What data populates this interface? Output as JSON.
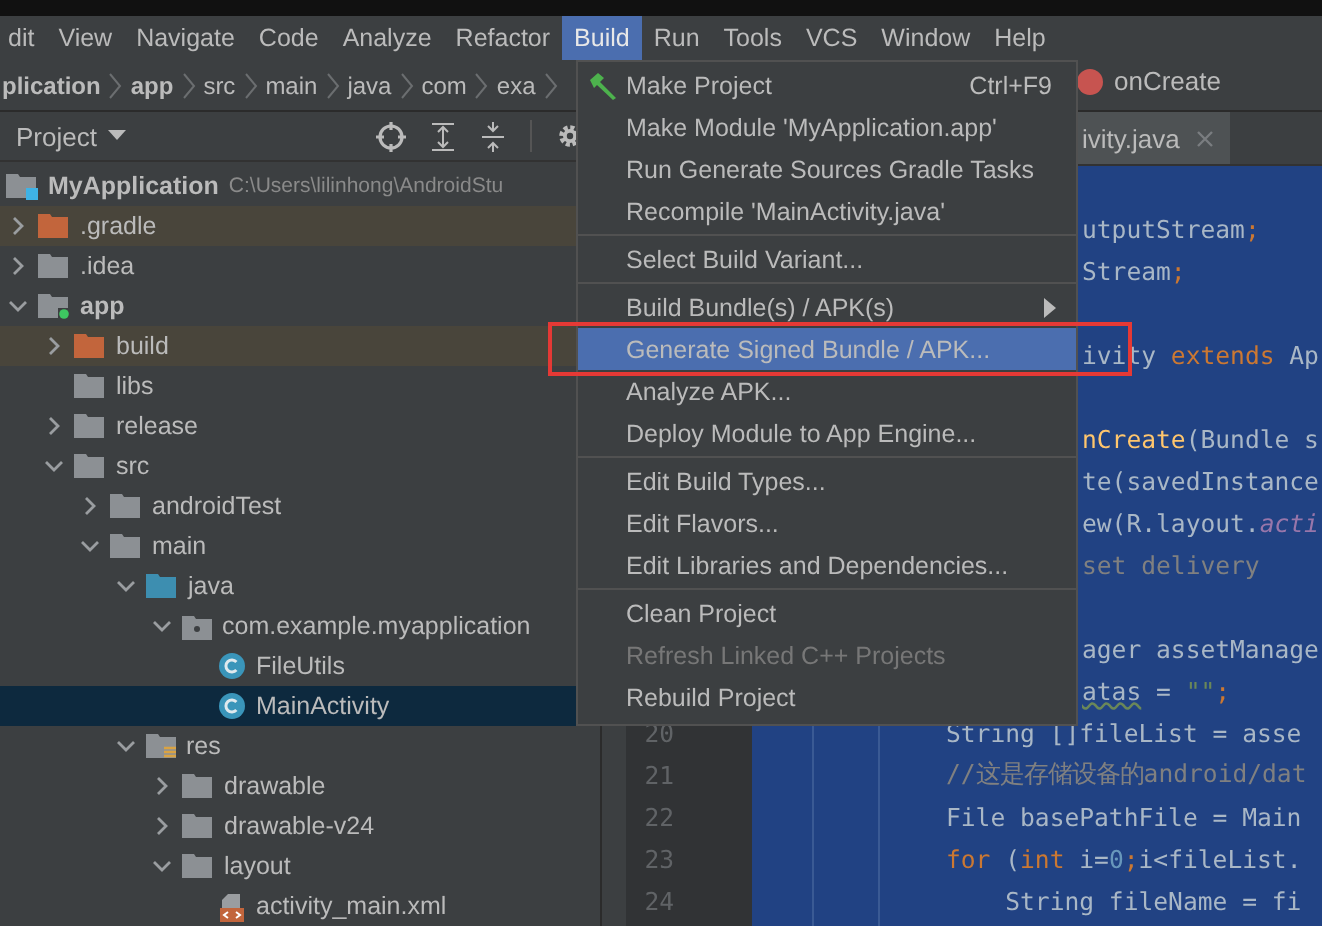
{
  "menu_bar": [
    {
      "label": "dit",
      "selected": false
    },
    {
      "label": "View",
      "selected": false
    },
    {
      "label": "Navigate",
      "selected": false
    },
    {
      "label": "Code",
      "selected": false
    },
    {
      "label": "Analyze",
      "selected": false
    },
    {
      "label": "Refactor",
      "selected": false
    },
    {
      "label": "Build",
      "selected": true
    },
    {
      "label": "Run",
      "selected": false
    },
    {
      "label": "Tools",
      "selected": false
    },
    {
      "label": "VCS",
      "selected": false
    },
    {
      "label": "Window",
      "selected": false
    },
    {
      "label": "Help",
      "selected": false
    }
  ],
  "breadcrumb": {
    "items": [
      {
        "label": "plication",
        "bold": true
      },
      {
        "label": "app",
        "bold": true
      },
      {
        "label": "src",
        "bold": false
      },
      {
        "label": "main",
        "bold": false
      },
      {
        "label": "java",
        "bold": false
      },
      {
        "label": "com",
        "bold": false
      },
      {
        "label": "exa",
        "bold": false
      }
    ],
    "method": "onCreate"
  },
  "project_panel": {
    "title": "Project",
    "tree": [
      {
        "label": "MyApplication",
        "path": "C:\\Users\\lilinhong\\AndroidStu",
        "kind": "module-folder",
        "excluded": false,
        "selected": false,
        "children": [
          {
            "label": ".gradle",
            "kind": "orange-folder",
            "expanded": false,
            "excluded": true,
            "selected": false
          },
          {
            "label": ".idea",
            "kind": "folder",
            "expanded": false,
            "excluded": false,
            "selected": false
          },
          {
            "label": "app",
            "kind": "module-folder",
            "expanded": true,
            "excluded": false,
            "selected": false,
            "children": [
              {
                "label": "build",
                "kind": "orange-folder",
                "expanded": false,
                "excluded": true,
                "selected": false
              },
              {
                "label": "libs",
                "kind": "folder",
                "excluded": false,
                "selected": false
              },
              {
                "label": "release",
                "kind": "folder",
                "expanded": false,
                "excluded": false,
                "selected": false
              },
              {
                "label": "src",
                "kind": "folder",
                "expanded": true,
                "excluded": false,
                "selected": false,
                "children": [
                  {
                    "label": "androidTest",
                    "kind": "folder",
                    "expanded": false,
                    "excluded": false,
                    "selected": false
                  },
                  {
                    "label": "main",
                    "kind": "folder",
                    "expanded": true,
                    "excluded": false,
                    "selected": false,
                    "children": [
                      {
                        "label": "java",
                        "kind": "source-folder",
                        "expanded": true,
                        "excluded": false,
                        "selected": false,
                        "children": [
                          {
                            "label": "com.example.myapplication",
                            "kind": "package",
                            "expanded": true,
                            "excluded": false,
                            "selected": false,
                            "children": [
                              {
                                "label": "FileUtils",
                                "kind": "class",
                                "excluded": false,
                                "selected": false
                              },
                              {
                                "label": "MainActivity",
                                "kind": "class",
                                "excluded": false,
                                "selected": true
                              }
                            ]
                          }
                        ]
                      },
                      {
                        "label": "res",
                        "kind": "resource-folder",
                        "expanded": true,
                        "excluded": false,
                        "selected": false,
                        "children": [
                          {
                            "label": "drawable",
                            "kind": "folder",
                            "expanded": false,
                            "excluded": false,
                            "selected": false
                          },
                          {
                            "label": "drawable-v24",
                            "kind": "folder",
                            "expanded": false,
                            "excluded": false,
                            "selected": false
                          },
                          {
                            "label": "layout",
                            "kind": "folder",
                            "expanded": true,
                            "excluded": false,
                            "selected": false,
                            "children": [
                              {
                                "label": "activity_main.xml",
                                "kind": "layout-file",
                                "excluded": false,
                                "selected": false
                              }
                            ]
                          }
                        ]
                      }
                    ]
                  }
                ]
              }
            ]
          }
        ]
      }
    ]
  },
  "editor": {
    "tab": {
      "label": "ivity.java",
      "selected": true
    },
    "lines": [
      {
        "kind": "blank"
      },
      {
        "kind": "code",
        "segments": [
          {
            "text": "utputStream",
            "kind": "plain"
          },
          {
            "text": ";",
            "kind": "keyword"
          }
        ]
      },
      {
        "kind": "code",
        "segments": [
          {
            "text": "Stream",
            "kind": "plain"
          },
          {
            "text": ";",
            "kind": "keyword"
          }
        ]
      },
      {
        "kind": "blank"
      },
      {
        "kind": "code",
        "segments": [
          {
            "text": "ivity ",
            "kind": "plain"
          },
          {
            "text": "extends",
            "kind": "keyword"
          },
          {
            "text": " Ap",
            "kind": "plain"
          }
        ]
      },
      {
        "kind": "blank"
      },
      {
        "kind": "code",
        "segments": [
          {
            "text": "nCreate",
            "kind": "method"
          },
          {
            "text": "(Bundle s",
            "kind": "plain"
          }
        ]
      },
      {
        "kind": "code",
        "segments": [
          {
            "text": "te(savedInstance",
            "kind": "plain"
          }
        ]
      },
      {
        "kind": "code",
        "segments": [
          {
            "text": "ew(R.layout.",
            "kind": "plain"
          },
          {
            "text": "acti",
            "kind": "field"
          }
        ]
      },
      {
        "kind": "code",
        "segments": [
          {
            "text": "set delivery",
            "kind": "comment"
          }
        ]
      },
      {
        "kind": "blank"
      },
      {
        "kind": "code",
        "segments": [
          {
            "text": "ager assetManage",
            "kind": "plain"
          }
        ]
      },
      {
        "kind": "code",
        "segments": [
          {
            "text": "atas",
            "kind": "warning"
          },
          {
            "text": " = ",
            "kind": "plain"
          },
          {
            "text": "\"\"",
            "kind": "string"
          },
          {
            "text": ";",
            "kind": "keyword"
          }
        ]
      },
      {
        "kind": "code",
        "number": "20",
        "segments": [
          {
            "text": "String []fileList = asse",
            "kind": "plain"
          }
        ]
      },
      {
        "kind": "code",
        "number": "21",
        "segments": [
          {
            "text": "//这是存储设备的android/dat",
            "kind": "comment"
          }
        ]
      },
      {
        "kind": "code",
        "number": "22",
        "segments": [
          {
            "text": "File basePathFile = Main",
            "kind": "plain"
          }
        ]
      },
      {
        "kind": "code",
        "number": "23",
        "segments": [
          {
            "text": "for",
            "kind": "keyword"
          },
          {
            "text": " (",
            "kind": "plain"
          },
          {
            "text": "int",
            "kind": "keyword"
          },
          {
            "text": " i=",
            "kind": "plain"
          },
          {
            "text": "0",
            "kind": "number"
          },
          {
            "text": ";",
            "kind": "keyword"
          },
          {
            "text": "i<fileList.",
            "kind": "plain"
          }
        ]
      },
      {
        "kind": "code",
        "number": "24",
        "segments": [
          {
            "text": "    String fileName = fi",
            "kind": "plain"
          }
        ]
      }
    ]
  },
  "build_menu": [
    {
      "kind": "icon-item",
      "label": "Make Project",
      "shortcut": "Ctrl+F9",
      "selected": false,
      "disabled": false,
      "marked": false
    },
    {
      "kind": "item",
      "label": "Make Module 'MyApplication.app'",
      "selected": false,
      "disabled": false,
      "marked": false
    },
    {
      "kind": "item",
      "label": "Run Generate Sources Gradle Tasks",
      "selected": false,
      "disabled": false,
      "marked": false
    },
    {
      "kind": "item",
      "label": "Recompile 'MainActivity.java'",
      "selected": false,
      "disabled": false,
      "marked": false
    },
    {
      "kind": "separator"
    },
    {
      "kind": "item",
      "label": "Select Build Variant...",
      "selected": false,
      "disabled": false,
      "marked": false
    },
    {
      "kind": "separator"
    },
    {
      "kind": "item",
      "label": "Build Bundle(s) / APK(s)",
      "submenu": true,
      "selected": false,
      "disabled": false,
      "marked": false
    },
    {
      "kind": "item",
      "label": "Generate Signed Bundle / APK...",
      "selected": true,
      "disabled": false,
      "marked": true
    },
    {
      "kind": "item",
      "label": "Analyze APK...",
      "selected": false,
      "disabled": false,
      "marked": false
    },
    {
      "kind": "item",
      "label": "Deploy Module to App Engine...",
      "selected": false,
      "disabled": false,
      "marked": false
    },
    {
      "kind": "separator"
    },
    {
      "kind": "item",
      "label": "Edit Build Types...",
      "selected": false,
      "disabled": false,
      "marked": false
    },
    {
      "kind": "item",
      "label": "Edit Flavors...",
      "selected": false,
      "disabled": false,
      "marked": false
    },
    {
      "kind": "item",
      "label": "Edit Libraries and Dependencies...",
      "selected": false,
      "disabled": false,
      "marked": false
    },
    {
      "kind": "separator"
    },
    {
      "kind": "item",
      "label": "Clean Project",
      "selected": false,
      "disabled": false,
      "marked": false
    },
    {
      "kind": "item",
      "label": "Refresh Linked C++ Projects",
      "selected": false,
      "disabled": true,
      "marked": false
    },
    {
      "kind": "item",
      "label": "Rebuild Project",
      "selected": false,
      "disabled": false,
      "marked": false
    }
  ]
}
